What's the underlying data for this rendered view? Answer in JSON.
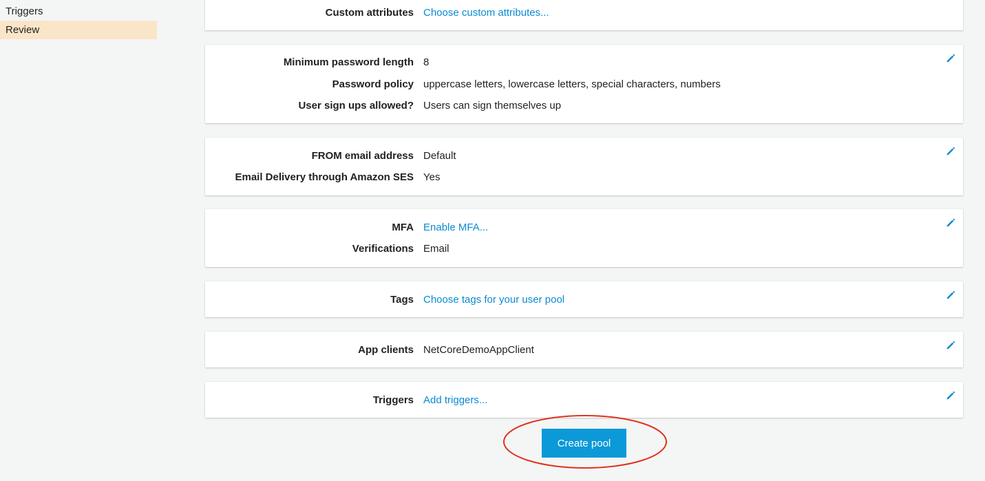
{
  "sidebar": {
    "items": [
      {
        "label": "Triggers",
        "active": false
      },
      {
        "label": "Review",
        "active": true
      }
    ]
  },
  "sections": {
    "attributes": {
      "custom_attributes_label": "Custom attributes",
      "custom_attributes_value": "Choose custom attributes..."
    },
    "policies": {
      "min_length_label": "Minimum password length",
      "min_length_value": "8",
      "policy_label": "Password policy",
      "policy_value": "uppercase letters, lowercase letters, special characters, numbers",
      "signups_label": "User sign ups allowed?",
      "signups_value": "Users can sign themselves up"
    },
    "email": {
      "from_label": "FROM email address",
      "from_value": "Default",
      "ses_label": "Email Delivery through Amazon SES",
      "ses_value": "Yes"
    },
    "mfa": {
      "mfa_label": "MFA",
      "mfa_value": "Enable MFA...",
      "verifications_label": "Verifications",
      "verifications_value": "Email"
    },
    "tags": {
      "tags_label": "Tags",
      "tags_value": "Choose tags for your user pool"
    },
    "app_clients": {
      "label": "App clients",
      "value": "NetCoreDemoAppClient"
    },
    "triggers": {
      "label": "Triggers",
      "value": "Add triggers..."
    }
  },
  "actions": {
    "create_pool_label": "Create pool"
  },
  "colors": {
    "link": "#0a8ad2",
    "primary_button": "#0b99d7",
    "active_nav": "#fbe5c8",
    "annotation": "#e0321c"
  },
  "icons": {
    "edit": "pencil-icon"
  }
}
